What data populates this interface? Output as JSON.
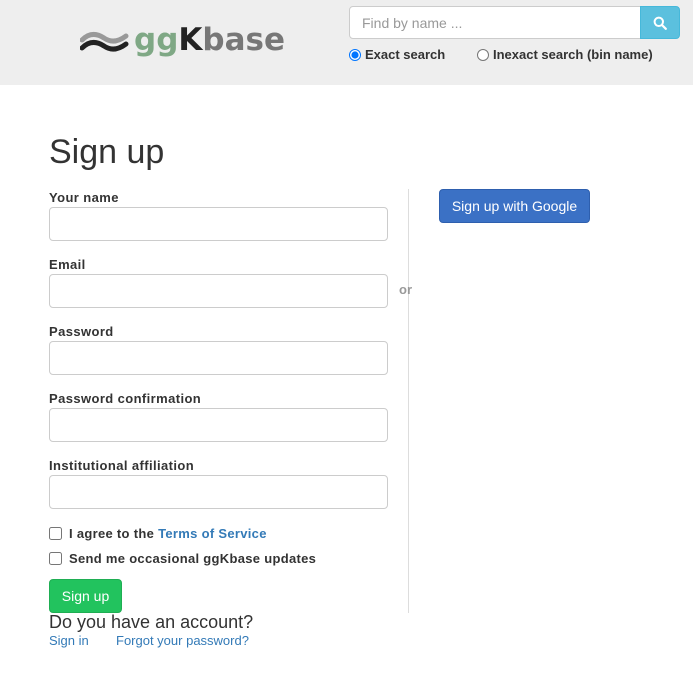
{
  "header": {
    "logo": {
      "gg": "gg",
      "k": "K",
      "base": "base"
    },
    "search": {
      "placeholder": "Find by name ...",
      "value": ""
    },
    "search_button_icon": "search-icon",
    "radio_exact_label": "Exact search",
    "radio_inexact_label": "Inexact search (bin name)",
    "selected_search_mode": "exact"
  },
  "form": {
    "title": "Sign up",
    "fields": {
      "name_label": "Your name",
      "email_label": "Email",
      "password_label": "Password",
      "password_confirm_label": "Password confirmation",
      "affiliation_label": "Institutional affiliation"
    },
    "terms_prefix": "I agree to the",
    "terms_link": "Terms of Service",
    "updates_label": "Send me occasional ggKbase updates",
    "submit_label": "Sign up",
    "have_account": "Do you have an account?",
    "sign_in_link": "Sign in",
    "forgot_link": "Forgot your password?"
  },
  "alt": {
    "or_text": "or",
    "google_label": "Sign up with Google"
  },
  "colors": {
    "header_bg": "#eeeeee",
    "search_button": "#5bc0de",
    "submit_button": "#22c35e",
    "google_button": "#3b71c5",
    "link": "#337ab7",
    "logo_green": "#7fa885"
  }
}
